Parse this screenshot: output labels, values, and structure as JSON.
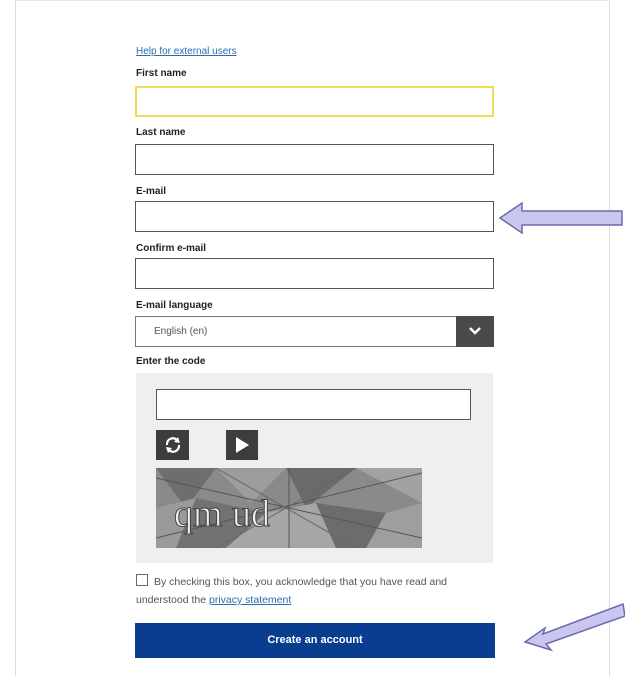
{
  "help_link": "Help for external users",
  "form": {
    "first_name_label": "First name",
    "last_name_label": "Last name",
    "email_label": "E-mail",
    "confirm_email_label": "Confirm e-mail",
    "email_language_label": "E-mail language",
    "email_language_value": "English (en)",
    "enter_code_label": "Enter the code"
  },
  "captcha": {
    "refresh_icon": "refresh-icon",
    "play_icon": "play-icon",
    "image_text": "qm ud"
  },
  "consent": {
    "text": "By checking this box, you acknowledge that you have read and understood the",
    "link": "privacy statement"
  },
  "create_button": "Create an account",
  "colors": {
    "primary": "#0a3d8f",
    "link": "#2b6cb0",
    "focus": "#f0dc5a",
    "arrow": "#c9c6ef"
  }
}
